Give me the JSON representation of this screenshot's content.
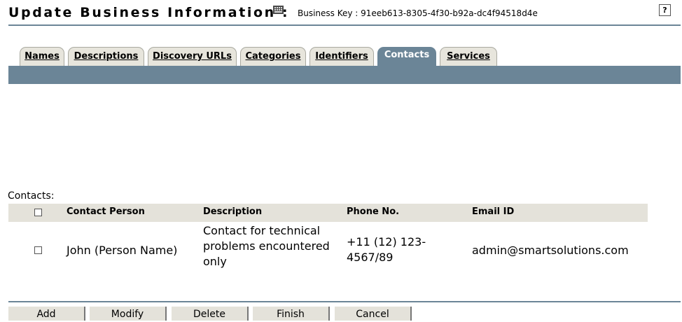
{
  "header": {
    "title": "Update Business Information :",
    "key_icon": "keypad-icon",
    "business_key_label": "Business Key : 91eeb613-8305-4f30-b92a-dc4f94518d4e",
    "help_label": "?"
  },
  "tabs": [
    {
      "label": "Names",
      "active": false
    },
    {
      "label": "Descriptions",
      "active": false
    },
    {
      "label": "Discovery URLs",
      "active": false
    },
    {
      "label": "Categories",
      "active": false
    },
    {
      "label": "Identifiers",
      "active": false
    },
    {
      "label": "Contacts",
      "active": true
    },
    {
      "label": "Services",
      "active": false
    }
  ],
  "contacts": {
    "section_label": "Contacts:",
    "columns": {
      "contact_person": "Contact Person",
      "description": "Description",
      "phone": "Phone No.",
      "email": "Email ID"
    },
    "rows": [
      {
        "contact_person": "John (Person Name)",
        "description": "Contact for technical problems encountered only",
        "phone": "+11 (12) 123-4567/89",
        "email": "admin@smartsolutions.com",
        "checked": false
      }
    ]
  },
  "buttons": {
    "add": "Add",
    "modify": "Modify",
    "delete": "Delete",
    "finish": "Finish",
    "cancel": "Cancel"
  },
  "colors": {
    "band": "#6b8597",
    "tab_bg": "#e7e5dc",
    "header_row": "#e4e2da"
  }
}
